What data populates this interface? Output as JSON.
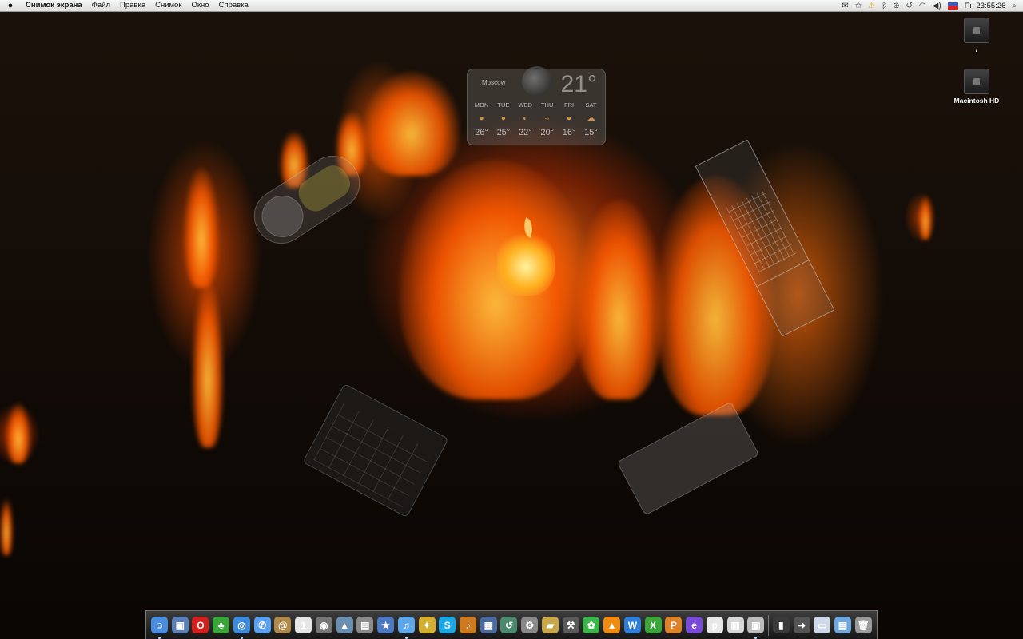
{
  "menubar": {
    "apple_icon": "apple-icon",
    "items": [
      "Снимок экрана",
      "Файл",
      "Правка",
      "Снимок",
      "Окно",
      "Справка"
    ],
    "status_icons": [
      "envelope-icon",
      "star-icon",
      "warning-icon",
      "bluetooth-icon",
      "sync-icon",
      "time-machine-icon",
      "wifi-icon",
      "volume-icon",
      "input-source-flag-icon"
    ],
    "clock": "Пн 23:55:26",
    "spotlight_icon": "search-icon"
  },
  "desktop": {
    "drives": [
      {
        "label": "/"
      },
      {
        "label": "Macintosh HD"
      }
    ]
  },
  "weather_widget": {
    "city": "Moscow",
    "current_temp": "21°",
    "days": [
      "MON",
      "TUE",
      "WED",
      "THU",
      "FRI",
      "SAT"
    ],
    "temps": [
      "26°",
      "25°",
      "22°",
      "20°",
      "16°",
      "15°"
    ],
    "conditions": [
      "sunny-icon",
      "sunny-icon",
      "partly-cloudy-icon",
      "windy-icon",
      "sunny-icon",
      "cloudy-icon"
    ]
  },
  "dock": {
    "apps": [
      {
        "name": "finder",
        "glyph": "☺",
        "color": "#4a8de0",
        "running": true
      },
      {
        "name": "preview",
        "glyph": "▣",
        "color": "#5b7fb8",
        "running": false
      },
      {
        "name": "opera",
        "glyph": "O",
        "color": "#d2201c",
        "running": false
      },
      {
        "name": "adium",
        "glyph": "♣",
        "color": "#3aa63a",
        "running": false
      },
      {
        "name": "safari",
        "glyph": "◎",
        "color": "#3d8be0",
        "running": true
      },
      {
        "name": "ichat",
        "glyph": "✆",
        "color": "#5aa0f0",
        "running": false
      },
      {
        "name": "address-book",
        "glyph": "@",
        "color": "#b08a4a",
        "running": false
      },
      {
        "name": "ical",
        "glyph": "1",
        "color": "#e6e6e6",
        "running": false
      },
      {
        "name": "screenshot",
        "glyph": "◉",
        "color": "#777",
        "running": false
      },
      {
        "name": "iphoto",
        "glyph": "▲",
        "color": "#6b8fb0",
        "running": false
      },
      {
        "name": "photo-booth",
        "glyph": "▤",
        "color": "#8b8b8b",
        "running": false
      },
      {
        "name": "imovie",
        "glyph": "★",
        "color": "#4e7ac4",
        "running": false
      },
      {
        "name": "itunes",
        "glyph": "♫",
        "color": "#5fa8e8",
        "running": true
      },
      {
        "name": "imovie-star",
        "glyph": "✦",
        "color": "#d4b030",
        "running": false
      },
      {
        "name": "skype",
        "glyph": "S",
        "color": "#1aa7e5",
        "running": false
      },
      {
        "name": "garageband",
        "glyph": "♪",
        "color": "#d07a20",
        "running": false
      },
      {
        "name": "spaces",
        "glyph": "▦",
        "color": "#4a6aa0",
        "running": false
      },
      {
        "name": "time-machine",
        "glyph": "↺",
        "color": "#4d8a70",
        "running": false
      },
      {
        "name": "system-preferences",
        "glyph": "⚙",
        "color": "#8a8a8a",
        "running": false
      },
      {
        "name": "utility",
        "glyph": "▰",
        "color": "#c8a84a",
        "running": false
      },
      {
        "name": "xcode",
        "glyph": "⚒",
        "color": "#5a5a5a",
        "running": false
      },
      {
        "name": "adium-green",
        "glyph": "✿",
        "color": "#3bb54a",
        "running": false
      },
      {
        "name": "vlc",
        "glyph": "▲",
        "color": "#f08a10",
        "running": false
      },
      {
        "name": "ms-word",
        "glyph": "W",
        "color": "#2f7fd8",
        "running": false
      },
      {
        "name": "ms-excel",
        "glyph": "X",
        "color": "#3aa63a",
        "running": false
      },
      {
        "name": "ms-powerpoint",
        "glyph": "P",
        "color": "#e0822a",
        "running": false
      },
      {
        "name": "ms-entourage",
        "glyph": "e",
        "color": "#7a4ad8",
        "running": false
      },
      {
        "name": "messenger",
        "glyph": "p",
        "color": "#e8e8e8",
        "running": false
      },
      {
        "name": "dashboard",
        "glyph": "▥",
        "color": "#d8d8d8",
        "running": false
      },
      {
        "name": "screenshot-app",
        "glyph": "▣",
        "color": "#bdbdbd",
        "running": true
      }
    ],
    "stacks": [
      {
        "name": "movies-folder",
        "glyph": "▮",
        "color": "#3a3a3a"
      },
      {
        "name": "downloads-folder",
        "glyph": "➜",
        "color": "#555"
      },
      {
        "name": "documents-folder",
        "glyph": "▭",
        "color": "#cfd8e8"
      },
      {
        "name": "screenshots-folder",
        "glyph": "▤",
        "color": "#6fa8e0"
      },
      {
        "name": "trash",
        "glyph": "🗑",
        "color": "#9a9a9a"
      }
    ]
  }
}
